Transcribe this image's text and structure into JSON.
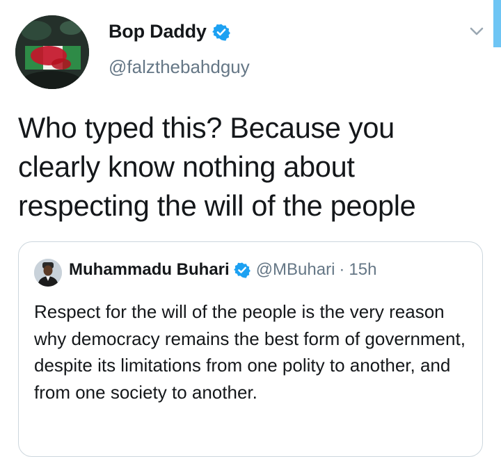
{
  "tweet": {
    "author": {
      "display_name": "Bop Daddy",
      "handle": "@falzthebahdguy",
      "verified": true
    },
    "text": "Who typed this? Because you clearly know nothing about respecting the will of the people",
    "menu_icon": "chevron-down-icon"
  },
  "quoted_tweet": {
    "author": {
      "display_name": "Muhammadu Buhari",
      "handle": "@MBuhari",
      "verified": true
    },
    "separator": "·",
    "time": "15h",
    "text": "Respect for the will of the people is the very reason why democracy remains the best form of government, despite its limitations from one polity to another, and from one society to another."
  },
  "colors": {
    "verified_badge": "#1da1f2",
    "secondary_text": "#657786",
    "border": "#ccd6dd",
    "scrollbar": "#6ec5f4"
  }
}
